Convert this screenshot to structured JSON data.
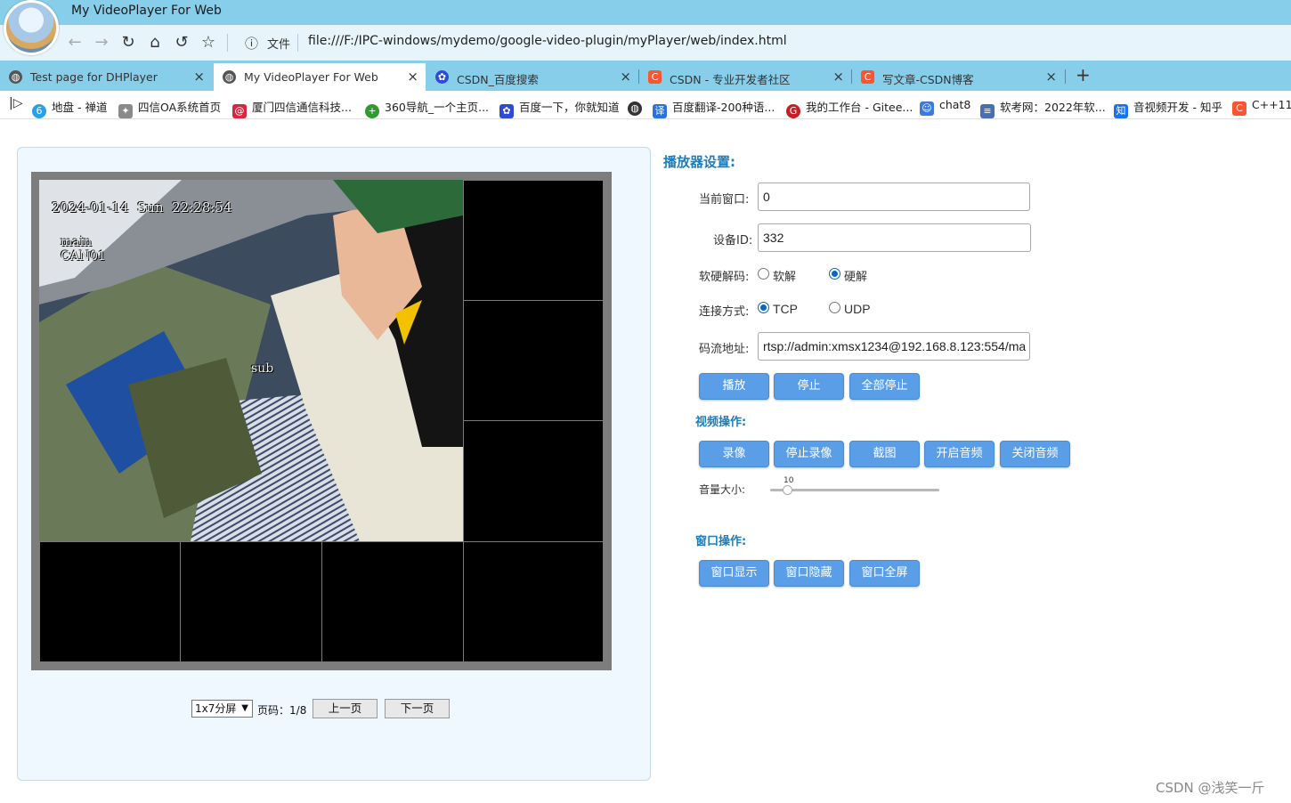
{
  "browser": {
    "window_title": "My VideoPlayer For Web",
    "file_label": "文件",
    "url": "file:///F:/IPC-windows/mydemo/google-video-plugin/myPlayer/web/index.html",
    "tabs": [
      {
        "label": "Test page for DHPlayer",
        "icon": "globe-icon",
        "icon_color": "#555555"
      },
      {
        "label": "My VideoPlayer For Web",
        "icon": "globe-icon",
        "icon_color": "#555555"
      },
      {
        "label": "CSDN_百度搜索",
        "icon": "paw-icon",
        "icon_color": "#2e4bd6"
      },
      {
        "label": "CSDN - 专业开发者社区",
        "icon": "csdn-icon",
        "icon_color": "#fc5531"
      },
      {
        "label": "写文章-CSDN博客",
        "icon": "csdn-icon",
        "icon_color": "#fc5531"
      }
    ],
    "bookmarks": [
      {
        "label": "地盘 - 禅道",
        "icon": "zentao-icon",
        "color": "#2aa0e8",
        "glyph": "6"
      },
      {
        "label": "四信OA系统首页",
        "icon": "oa-icon",
        "color": "#8a8a8a",
        "glyph": "✦"
      },
      {
        "label": "厦门四信通信科技...",
        "icon": "mail-icon",
        "color": "#d7263d",
        "glyph": "@"
      },
      {
        "label": "360导航_一个主页...",
        "icon": "360-icon",
        "color": "#2f9a2f",
        "glyph": "+"
      },
      {
        "label": "百度一下，你就知道",
        "icon": "paw-icon",
        "color": "#2e4bd6",
        "glyph": "✿"
      },
      {
        "label": "",
        "icon": "globe-icon",
        "color": "#333333",
        "glyph": "◍"
      },
      {
        "label": "百度翻译-200种语...",
        "icon": "translate-icon",
        "color": "#2a72de",
        "glyph": "译"
      },
      {
        "label": "我的工作台 - Gitee...",
        "icon": "gitee-icon",
        "color": "#c71d23",
        "glyph": "G"
      },
      {
        "label": "chat8",
        "icon": "chat-icon",
        "color": "#3b7be0",
        "glyph": "☺"
      },
      {
        "label": "软考网：2022年软...",
        "icon": "rk-icon",
        "color": "#4a6fb0",
        "glyph": "≡"
      },
      {
        "label": "音视频开发 - 知乎",
        "icon": "zhihu-icon",
        "color": "#1772f6",
        "glyph": "知"
      },
      {
        "label": "C++11",
        "icon": "csdn-icon",
        "color": "#fc5531",
        "glyph": "C"
      }
    ]
  },
  "player": {
    "osd_datetime": "2024-01-14  Sun  22:28:54",
    "osd_stream": "main\nCAN01",
    "osd_sub": "sub",
    "split_option": "1x7分屏",
    "page_label": "页码：",
    "page_value": "1/8",
    "prev_page": "上一页",
    "next_page": "下一页"
  },
  "settings": {
    "title": "播放器设置:",
    "window_label": "当前窗口:",
    "window_value": "0",
    "device_label": "设备ID:",
    "device_value": "332",
    "decode_label": "软硬解码:",
    "decode_soft": "软解",
    "decode_hard": "硬解",
    "decode_selected": "硬解",
    "conn_label": "连接方式:",
    "conn_tcp": "TCP",
    "conn_udp": "UDP",
    "conn_selected": "TCP",
    "stream_label": "码流地址:",
    "stream_value": "rtsp://admin:xmsx1234@192.168.8.123:554/ma",
    "play": "播放",
    "stop": "停止",
    "stop_all": "全部停止"
  },
  "video_ops": {
    "title": "视频操作:",
    "record": "录像",
    "stop_record": "停止录像",
    "snapshot": "截图",
    "audio_on": "开启音频",
    "audio_off": "关闭音频",
    "volume_label": "音量大小:",
    "volume_value": "10",
    "volume_max": 100
  },
  "window_ops": {
    "title": "窗口操作:",
    "show": "窗口显示",
    "hide": "窗口隐藏",
    "fullscreen": "窗口全屏"
  },
  "watermark": "CSDN @浅笑一斤"
}
